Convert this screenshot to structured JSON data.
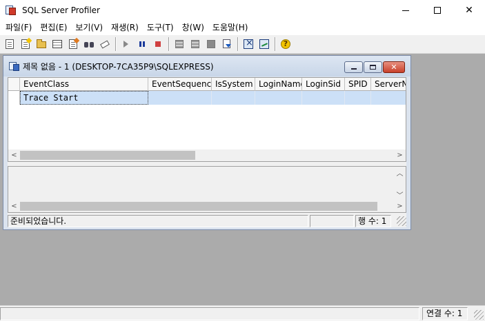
{
  "app": {
    "title": "SQL Server Profiler"
  },
  "menu": [
    {
      "label": "파일(F)"
    },
    {
      "label": "편집(E)"
    },
    {
      "label": "보기(V)"
    },
    {
      "label": "재생(R)"
    },
    {
      "label": "도구(T)"
    },
    {
      "label": "창(W)"
    },
    {
      "label": "도움말(H)"
    }
  ],
  "child": {
    "title": "제목 없음 - 1 (DESKTOP-7CA35P9\\SQLEXPRESS)",
    "columns": [
      "EventClass",
      "EventSequence",
      "IsSystem",
      "LoginName",
      "LoginSid",
      "SPID",
      "ServerName"
    ],
    "rows": [
      {
        "EventClass": "Trace Start",
        "EventSequence": "",
        "IsSystem": "",
        "LoginName": "",
        "LoginSid": "",
        "SPID": "",
        "ServerName": ""
      }
    ],
    "status": {
      "message": "준비되었습니다.",
      "row_count": "행 수: 1"
    }
  },
  "main_status": {
    "connections": "연결 수: 1"
  },
  "colors": {
    "selected_row": "#cce0f7",
    "mdi_background": "#ababab",
    "child_frame": "#dbe3ee"
  }
}
